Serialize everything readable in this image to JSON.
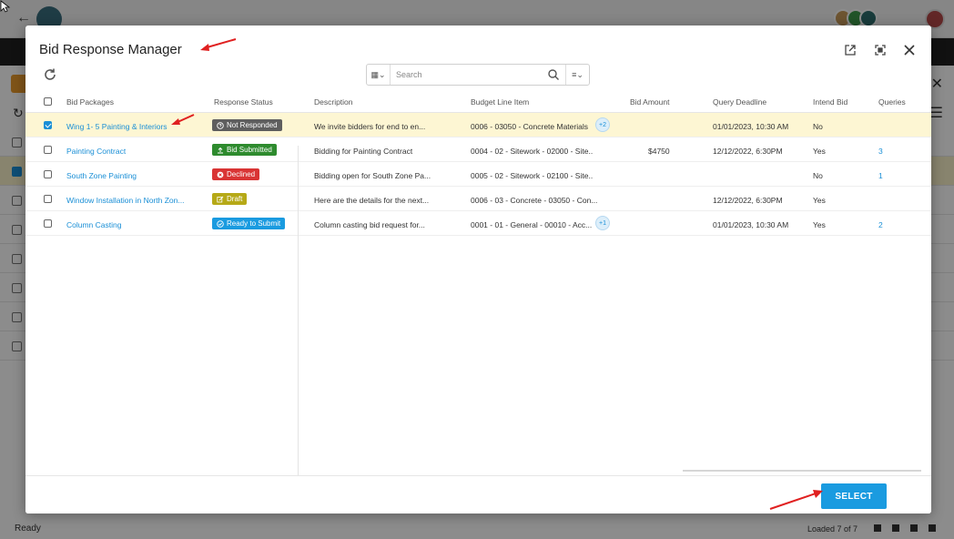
{
  "background": {
    "status_text": "Ready",
    "loaded_text": "Loaded 7 of 7",
    "colors": {
      "accent": "#1a8fd6",
      "orange": "#e89a2c"
    }
  },
  "modal": {
    "title": "Bid Response Manager",
    "search": {
      "placeholder": "Search"
    },
    "select_button": "SELECT",
    "columns": {
      "bid_packages": "Bid Packages",
      "response_status": "Response Status",
      "description": "Description",
      "budget_line_item": "Budget Line Item",
      "bid_amount": "Bid Amount",
      "query_deadline": "Query Deadline",
      "intend_bid": "Intend Bid",
      "queries": "Queries"
    },
    "rows": [
      {
        "bid_package": "Wing 1- 5 Painting & Interiors",
        "status": "Not Responded",
        "status_icon": "help-circle-icon",
        "status_color": "#5e5e5e",
        "description": "We invite bidders for end to en...",
        "budget_line_item": "0006 - 03050 - Concrete Materials",
        "budget_extra": "+2",
        "bid_amount": "",
        "query_deadline": "01/01/2023, 10:30 AM",
        "intend_bid": "No",
        "queries": "",
        "checked": true
      },
      {
        "bid_package": "Painting Contract",
        "status": "Bid Submitted",
        "status_icon": "upload-icon",
        "status_color": "#2e8b2e",
        "description": "Bidding for Painting Contract",
        "budget_line_item": "0004 - 02 - Sitework - 02000 - Site..",
        "budget_extra": "",
        "bid_amount": "$4750",
        "query_deadline": "12/12/2022, 6:30PM",
        "intend_bid": "Yes",
        "queries": "3",
        "checked": false
      },
      {
        "bid_package": "South Zone Painting",
        "status": "Declined",
        "status_icon": "x-circle-icon",
        "status_color": "#d93434",
        "description": "Bidding open for South Zone Pa...",
        "budget_line_item": "0005 - 02 - Sitework - 02100 - Site..",
        "budget_extra": "",
        "bid_amount": "",
        "query_deadline": "",
        "intend_bid": "No",
        "queries": "1",
        "checked": false
      },
      {
        "bid_package": "Window Installation in North Zon...",
        "status": "Draft",
        "status_icon": "edit-icon",
        "status_color": "#b6a917",
        "description": "Here are the details for the next...",
        "budget_line_item": "0006 - 03 - Concrete - 03050 - Con...",
        "budget_extra": "",
        "bid_amount": "",
        "query_deadline": "12/12/2022, 6:30PM",
        "intend_bid": "Yes",
        "queries": "",
        "checked": false
      },
      {
        "bid_package": "Column Casting",
        "status": "Ready to Submit",
        "status_icon": "check-circle-icon",
        "status_color": "#1a9be0",
        "description": "Column casting bid request for...",
        "budget_line_item": "0001 - 01 - General - 00010 - Acc...",
        "budget_extra": "+1",
        "bid_amount": "",
        "query_deadline": "01/01/2023, 10:30 AM",
        "intend_bid": "Yes",
        "queries": "2",
        "checked": false
      }
    ]
  }
}
